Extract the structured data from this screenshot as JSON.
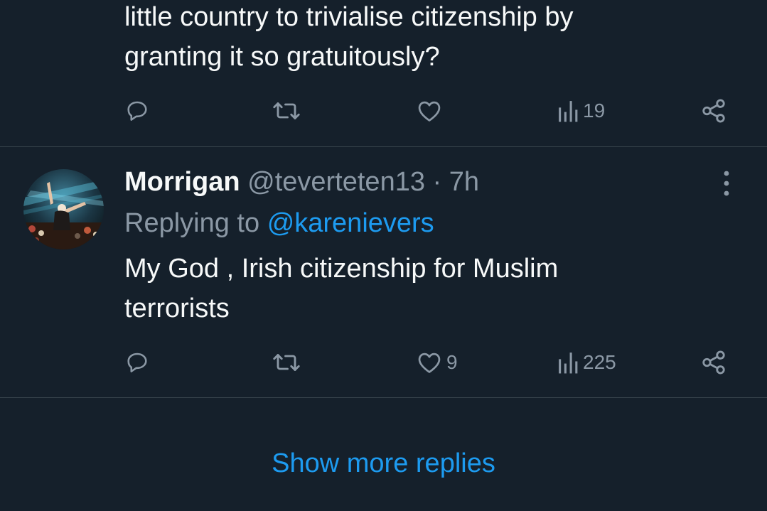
{
  "tweet_1": {
    "text_lines": [
      "little country to trivialise citizenship by",
      "granting it so gratuitously?"
    ],
    "actions": {
      "reply_icon": "reply-bubble-icon",
      "retweet_icon": "retweet-icon",
      "like_icon": "heart-icon",
      "like_count": "",
      "views_icon": "views-bar-chart-icon",
      "views_count": "19",
      "share_icon": "share-icon"
    }
  },
  "tweet_2": {
    "display_name": "Morrigan",
    "handle": "@teverteten13",
    "separator": "·",
    "time": "7h",
    "replying_prefix": "Replying to",
    "replying_handle": "@karenievers",
    "text_lines": [
      "My God , Irish citizenship for Muslim",
      "terrorists"
    ],
    "actions": {
      "reply_icon": "reply-bubble-icon",
      "retweet_icon": "retweet-icon",
      "like_icon": "heart-icon",
      "like_count": "9",
      "views_icon": "views-bar-chart-icon",
      "views_count": "225",
      "share_icon": "share-icon"
    },
    "more_icon": "more-vertical-icon"
  },
  "show_more_replies": "Show more replies",
  "colors": {
    "background": "#15202b",
    "text": "#f7f9f9",
    "secondary_text": "#8b98a5",
    "link": "#1d9bf0",
    "divider": "#38444d"
  }
}
